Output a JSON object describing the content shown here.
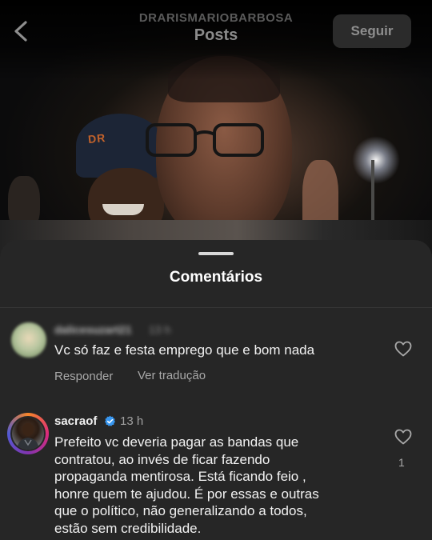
{
  "header": {
    "account": "DRARISMARIOBARBOSA",
    "title": "Posts",
    "follow_label": "Seguir"
  },
  "photo": {
    "hat_text": "DR"
  },
  "sheet": {
    "title": "Comentários"
  },
  "comments": [
    {
      "username": "dalicesuzart21",
      "time": "13 h",
      "text": "Vc só faz e festa emprego que e bom nada",
      "reply_label": "Responder",
      "translate_label": "Ver tradução"
    },
    {
      "username": "sacraof",
      "time": "13 h",
      "text": "Prefeito vc deveria pagar as bandas que\ncontratou, ao invés de ficar fazendo\npropaganda mentirosa. Está ficando feio ,\nhonre quem te ajudou.  É por essas e outras\nque o político, não generalizando a todos,\nestão sem credibilidade.",
      "likes": "1"
    }
  ],
  "colors": {
    "sheet_bg": "#262626",
    "verified_blue": "#3897f0",
    "follow_bg": "#2b2b2b"
  },
  "icons": [
    "chevron-left-icon",
    "heart-icon",
    "verified-badge-icon"
  ]
}
